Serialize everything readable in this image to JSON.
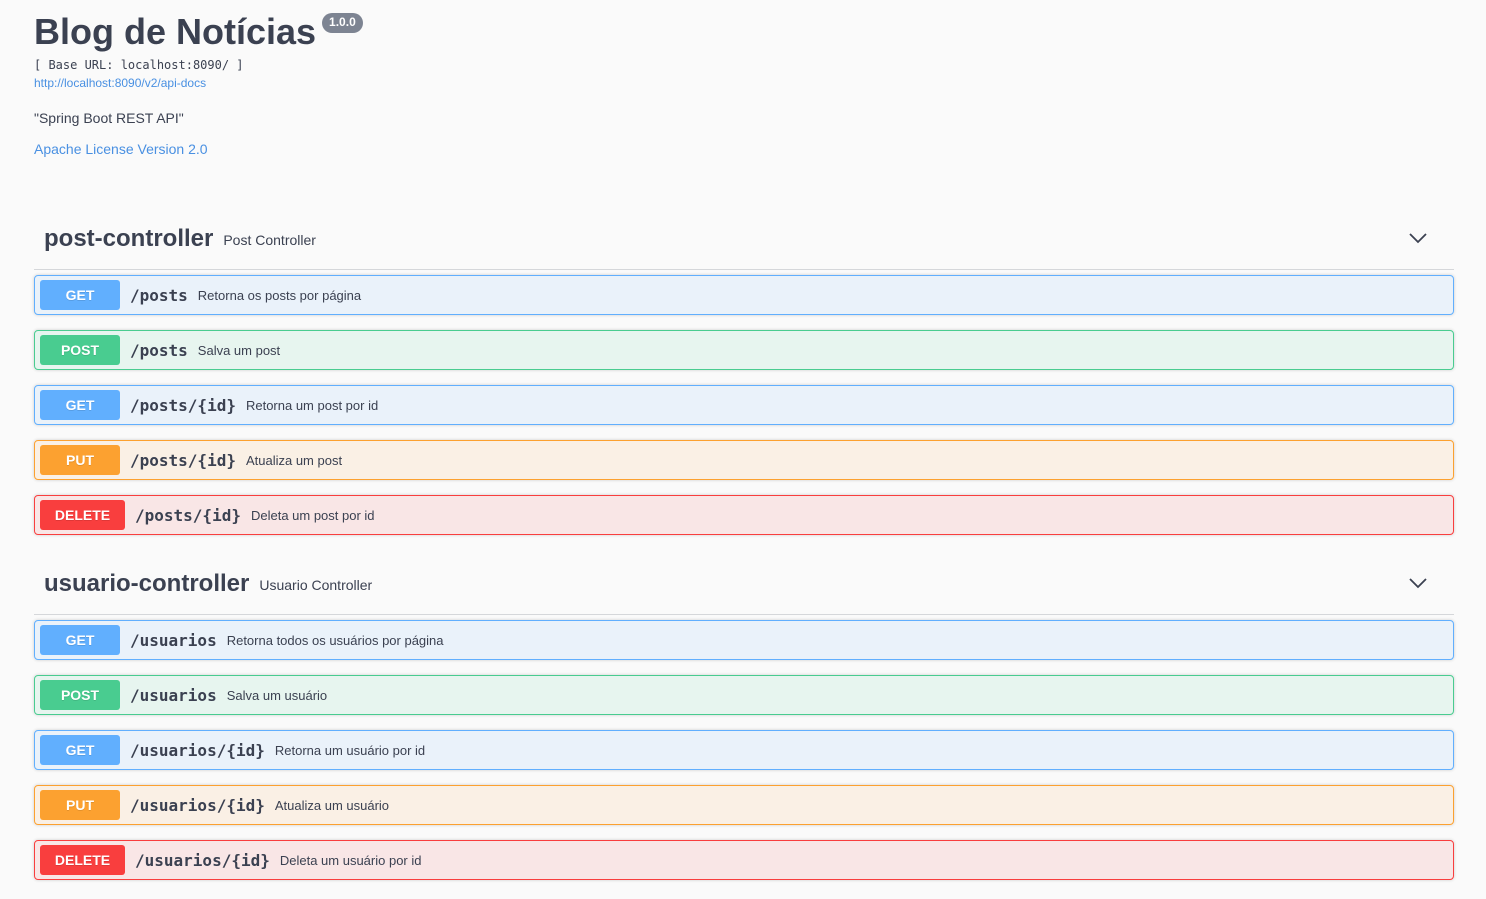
{
  "info": {
    "title": "Blog de Notícias",
    "version": "1.0.0",
    "base_url": "[ Base URL: localhost:8090/ ]",
    "spec_link": "http://localhost:8090/v2/api-docs",
    "description": "\"Spring Boot REST API\"",
    "license": "Apache License Version 2.0"
  },
  "tags": [
    {
      "name": "post-controller",
      "description": "Post Controller",
      "operations": [
        {
          "method": "GET",
          "path": "/posts",
          "summary": "Retorna os posts por página"
        },
        {
          "method": "POST",
          "path": "/posts",
          "summary": "Salva um post"
        },
        {
          "method": "GET",
          "path": "/posts/{id}",
          "summary": "Retorna um post por id"
        },
        {
          "method": "PUT",
          "path": "/posts/{id}",
          "summary": "Atualiza um post"
        },
        {
          "method": "DELETE",
          "path": "/posts/{id}",
          "summary": "Deleta um post por id"
        }
      ]
    },
    {
      "name": "usuario-controller",
      "description": "Usuario Controller",
      "operations": [
        {
          "method": "GET",
          "path": "/usuarios",
          "summary": "Retorna todos os usuários por página"
        },
        {
          "method": "POST",
          "path": "/usuarios",
          "summary": "Salva um usuário"
        },
        {
          "method": "GET",
          "path": "/usuarios/{id}",
          "summary": "Retorna um usuário por id"
        },
        {
          "method": "PUT",
          "path": "/usuarios/{id}",
          "summary": "Atualiza um usuário"
        },
        {
          "method": "DELETE",
          "path": "/usuarios/{id}",
          "summary": "Deleta um usuário por id"
        }
      ]
    }
  ],
  "colors": {
    "get": "#61affe",
    "post": "#49cc90",
    "put": "#fca130",
    "delete": "#f93e3e",
    "link": "#4990e2",
    "text": "#3b4151"
  },
  "icons": {
    "tag_toggle": "chevron-down-icon"
  }
}
